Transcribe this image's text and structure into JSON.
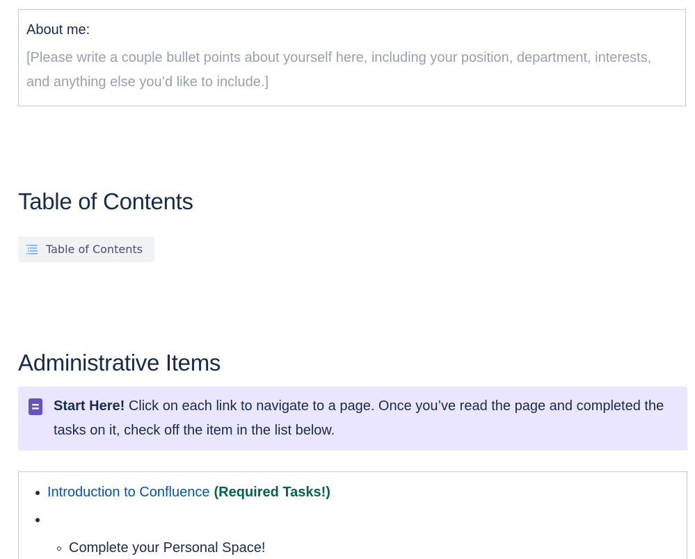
{
  "about": {
    "label": "About me:",
    "placeholder": "[Please write a couple bullet points about yourself here, including your position, department, interests, and anything else you’d like to include.]"
  },
  "toc": {
    "heading": "Table of Contents",
    "chip_label": "Table of Contents",
    "chip_icon": "toc-lines-icon"
  },
  "admin": {
    "heading": "Administrative Items",
    "panel": {
      "icon": "note-icon",
      "bold": "Start Here!",
      "text": " Click on each link to navigate to a page. Once you’ve read the page and completed the tasks on it, check off the item in the list below."
    },
    "list": {
      "item1_link": "Introduction to Confluence",
      "item1_tag": "(Required Tasks!)",
      "sub_item1": "Complete your Personal Space!"
    }
  },
  "colors": {
    "heading": "#172B4D",
    "placeholder": "#97A0AF",
    "link": "#0052CC",
    "required": "#006644",
    "panel_bg": "#EAE6FF",
    "panel_icon": "#6554C0",
    "border": "#C1C7D0"
  }
}
